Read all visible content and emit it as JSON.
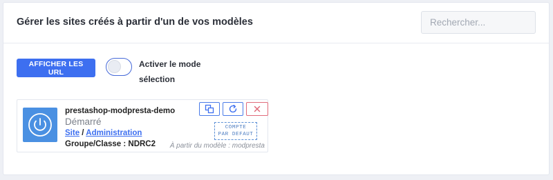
{
  "panel": {
    "title": "Gérer les sites créés à partir d'un de vos modèles",
    "search_placeholder": "Rechercher..."
  },
  "controls": {
    "show_urls_label": "AFFICHER LES URL",
    "selection_mode_label_line1": "Activer le mode",
    "selection_mode_label_line2": "sélection",
    "selection_mode_enabled": false
  },
  "site": {
    "name": "prestashop-modpresta-demo",
    "status": "Démarré",
    "link_site": "Site",
    "link_separator": " / ",
    "link_admin": "Administration",
    "group": "Groupe/Classe : NDRC2",
    "default_stamp_line1": "COMPTE",
    "default_stamp_line2": "PAR DEFAUT",
    "template_note": "À partir du modèle : modpresta",
    "icons": {
      "status": "power-icon",
      "duplicate": "duplicate-icon",
      "refresh": "refresh-icon",
      "delete": "close-icon"
    },
    "colors": {
      "status_tile": "#4a90e2",
      "action": "#4a7be8",
      "danger": "#e06a7a",
      "link": "#3d6ff0"
    }
  }
}
